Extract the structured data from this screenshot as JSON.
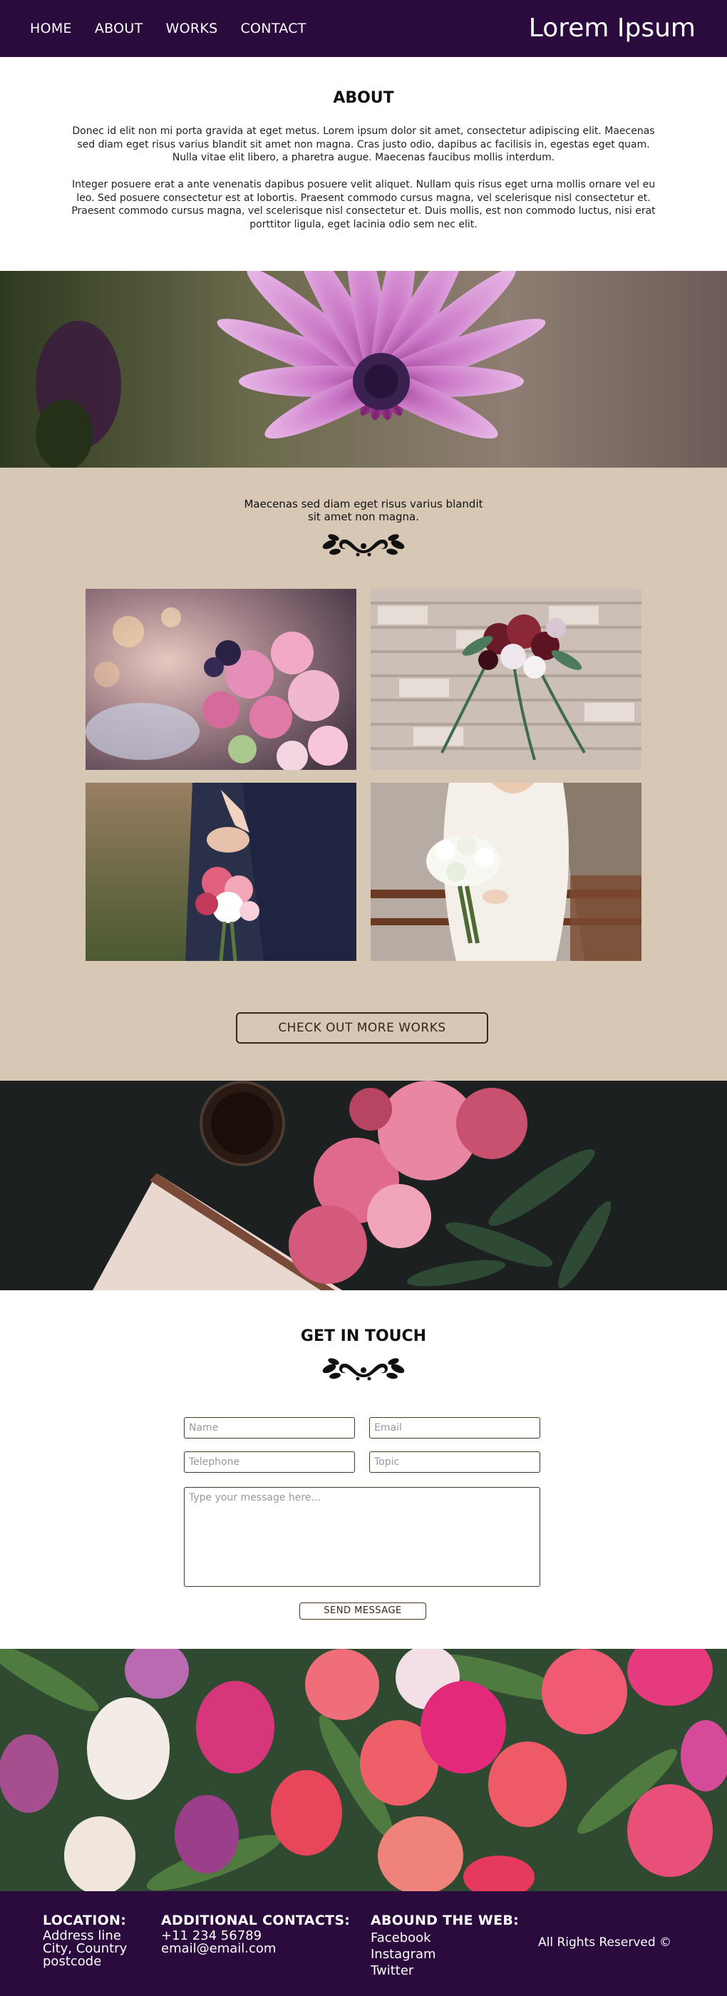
{
  "nav": {
    "links": [
      "HOME",
      "ABOUT",
      "WORKS",
      "CONTACT"
    ],
    "brand": "Lorem Ipsum"
  },
  "about": {
    "title": "ABOUT",
    "paragraphs": [
      "Donec id elit non mi porta gravida at eget metus. Lorem ipsum dolor sit amet, consectetur adipiscing elit. Maecenas sed diam eget risus varius blandit sit amet non magna. Cras justo odio, dapibus ac facilisis in, egestas eget quam. Nulla vitae elit libero, a pharetra augue. Maecenas faucibus mollis interdum.",
      "Integer posuere erat a ante venenatis dapibus posuere velit aliquet. Nullam quis risus eget urna mollis ornare vel eu leo. Sed posuere consectetur est at lobortis. Praesent commodo cursus magna, vel scelerisque nisl consectetur et. Praesent commodo cursus magna, vel scelerisque nisl consectetur et. Duis mollis, est non commodo luctus, nisi erat porttitor ligula, eget lacinia odio sem nec elit."
    ]
  },
  "works": {
    "tagline_line1": "Maecenas sed diam eget risus varius blandit",
    "tagline_line2": "sit amet non magna.",
    "more_button": "CHECK OUT MORE WORKS"
  },
  "contact": {
    "title": "GET IN TOUCH",
    "placeholders": {
      "name": "Name",
      "email": "Email",
      "telephone": "Telephone",
      "topic": "Topic",
      "message": "Type your message here..."
    },
    "send_button": "SEND MESSAGE"
  },
  "footer": {
    "location_heading": "LOCATION:",
    "location_lines": [
      "Address line",
      "City, Country",
      "postcode"
    ],
    "contacts_heading": "ADDITIONAL CONTACTS:",
    "contacts_lines": [
      "+11 234 56789",
      "email@email.com"
    ],
    "web_heading": "ABOUND THE WEB:",
    "web_links": [
      "Facebook",
      "Instagram",
      "Twitter"
    ],
    "rights": "All Rights Reserved ©"
  },
  "colors": {
    "nav_bg": "#2b0a3d",
    "works_bg": "#d7c8b6",
    "button_border": "#3a2412"
  },
  "icons": [
    "floral-ornament-icon"
  ]
}
